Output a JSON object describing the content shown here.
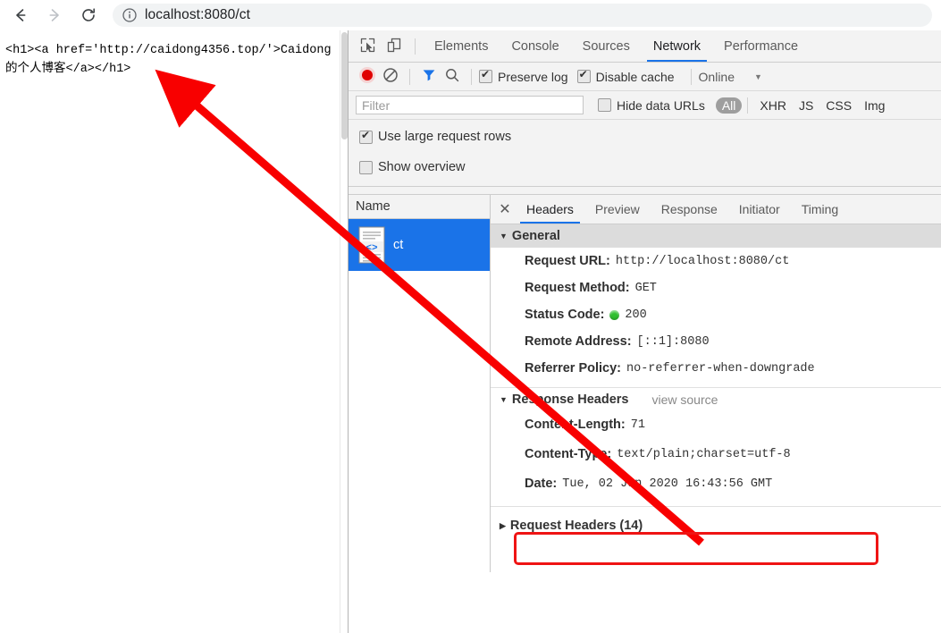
{
  "browser": {
    "back_icon": "arrow-left-icon",
    "forward_icon": "arrow-right-icon",
    "reload_icon": "reload-icon",
    "info_icon": "info-circle-icon",
    "url": "localhost:8080/ct"
  },
  "page": {
    "body_text": "<h1><a href='http://caidong4356.top/'>Caidong的个人博客</a></h1>"
  },
  "devtools": {
    "inspect_icon": "inspect-element-icon",
    "device_icon": "device-toolbar-icon",
    "tabs": [
      {
        "label": "Elements",
        "active": false
      },
      {
        "label": "Console",
        "active": false
      },
      {
        "label": "Sources",
        "active": false
      },
      {
        "label": "Network",
        "active": true
      },
      {
        "label": "Performance",
        "active": false
      }
    ],
    "toolbar": {
      "record_icon": "record-circle-icon",
      "clear_icon": "clear-prohibited-icon",
      "filter_icon": "funnel-filter-icon",
      "search_icon": "search-magnifier-icon",
      "preserve_log": {
        "label": "Preserve log",
        "checked": true
      },
      "disable_cache": {
        "label": "Disable cache",
        "checked": true
      },
      "throttling": {
        "value": "Online",
        "caret": "▼"
      }
    },
    "filterbar": {
      "placeholder": "Filter",
      "value": "",
      "hide_data_urls": {
        "label": "Hide data URLs",
        "checked": false
      },
      "types": [
        "All",
        "XHR",
        "JS",
        "CSS",
        "Img"
      ],
      "selected_type": "All"
    },
    "settings": [
      {
        "label": "Use large request rows",
        "checked": true
      },
      {
        "label": "Show overview",
        "checked": false
      }
    ],
    "request_list": {
      "column_header": "Name",
      "rows": [
        {
          "name": "ct",
          "icon": "document-code-icon",
          "selected": true
        }
      ]
    },
    "detail": {
      "close_icon": "close-icon",
      "tabs": [
        {
          "label": "Headers",
          "active": true
        },
        {
          "label": "Preview",
          "active": false
        },
        {
          "label": "Response",
          "active": false
        },
        {
          "label": "Initiator",
          "active": false
        },
        {
          "label": "Timing",
          "active": false
        }
      ],
      "general": {
        "title": "General",
        "expanded": true,
        "triangle": "▼",
        "rows": [
          {
            "name": "Request URL:",
            "value": "http://localhost:8080/ct"
          },
          {
            "name": "Request Method:",
            "value": "GET"
          },
          {
            "name": "Status Code:",
            "value": "200",
            "status_dot": "#30c030"
          },
          {
            "name": "Remote Address:",
            "value": "[::1]:8080"
          },
          {
            "name": "Referrer Policy:",
            "value": "no-referrer-when-downgrade"
          }
        ]
      },
      "response_headers": {
        "title": "Response Headers",
        "expanded": true,
        "triangle": "▼",
        "view_source": "view source",
        "rows": [
          {
            "name": "Content-Length:",
            "value": "71"
          },
          {
            "name": "Content-Type:",
            "value": "text/plain;charset=utf-8",
            "highlighted": true
          },
          {
            "name": "Date:",
            "value": "Tue, 02 Jun 2020 16:43:56 GMT"
          }
        ]
      },
      "request_headers": {
        "title": "Request Headers (14)",
        "expanded": false,
        "triangle": "▶"
      }
    }
  },
  "annotations": {
    "highlight_color": "#ef1414",
    "arrow_color": "#f80000",
    "arrow_label": "arrow-pointing-from-content-type-to-page-text"
  }
}
